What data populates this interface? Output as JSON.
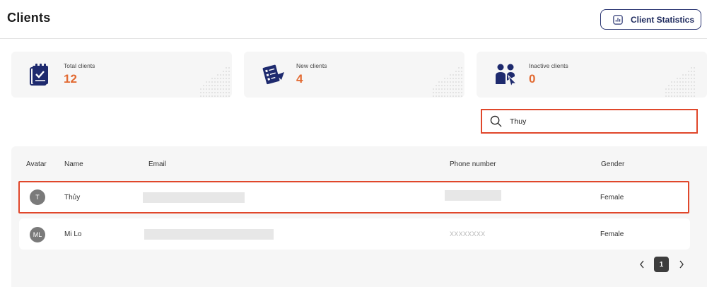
{
  "header": {
    "title": "Clients",
    "stats_button_label": "Client Statistics"
  },
  "cards": [
    {
      "label": "Total clients",
      "value": "12",
      "icon": "clipboard-check-icon"
    },
    {
      "label": "New clients",
      "value": "4",
      "icon": "new-client-form-icon"
    },
    {
      "label": "Inactive clients",
      "value": "0",
      "icon": "inactive-users-icon"
    }
  ],
  "search": {
    "value": "Thuy",
    "icon": "search-icon"
  },
  "table": {
    "columns": [
      "Avatar",
      "Name",
      "Email",
      "Phone number",
      "Gender"
    ],
    "rows": [
      {
        "initials": "T",
        "name": "Thủy",
        "email": "",
        "phone": "",
        "gender": "Female"
      },
      {
        "initials": "ML",
        "name": "Mi Lo",
        "email": "",
        "phone": "XXXXXXXX",
        "gender": "Female"
      }
    ]
  },
  "pagination": {
    "current_page": "1"
  },
  "colors": {
    "accent": "#e26a32",
    "highlight": "#e0472b",
    "navy": "#2b3672"
  }
}
